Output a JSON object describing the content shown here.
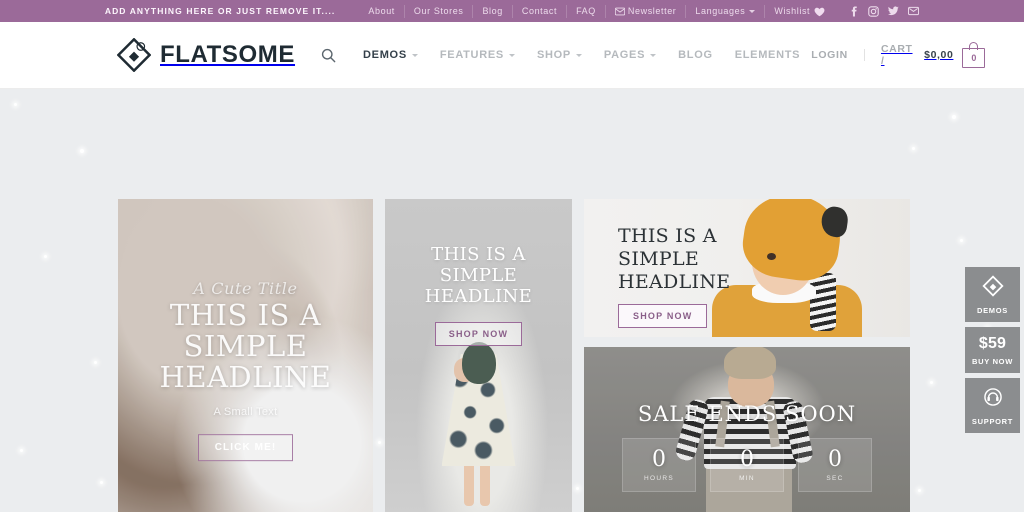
{
  "topbar": {
    "promo": "ADD ANYTHING HERE OR JUST REMOVE IT....",
    "links": [
      {
        "label": "About",
        "icon": null,
        "caret": false
      },
      {
        "label": "Our Stores",
        "icon": null,
        "caret": false
      },
      {
        "label": "Blog",
        "icon": null,
        "caret": false
      },
      {
        "label": "Contact",
        "icon": null,
        "caret": false
      },
      {
        "label": "FAQ",
        "icon": null,
        "caret": false
      },
      {
        "label": "Newsletter",
        "icon": "envelope-icon",
        "caret": false
      },
      {
        "label": "Languages",
        "icon": null,
        "caret": true
      },
      {
        "label": "Wishlist",
        "icon": "heart-icon",
        "caret": false
      }
    ],
    "social": [
      "facebook-icon",
      "instagram-icon",
      "twitter-icon",
      "email-icon"
    ],
    "bg_color": "#9b6a99"
  },
  "header": {
    "brand": "FLATSOME",
    "nav": [
      {
        "label": "DEMOS",
        "caret": true,
        "active": true
      },
      {
        "label": "FEATURES",
        "caret": true,
        "active": false
      },
      {
        "label": "SHOP",
        "caret": true,
        "active": false
      },
      {
        "label": "PAGES",
        "caret": true,
        "active": false
      },
      {
        "label": "BLOG",
        "caret": false,
        "active": false
      },
      {
        "label": "ELEMENTS",
        "caret": false,
        "active": false
      }
    ],
    "login": "LOGIN",
    "cart_label": "CART /",
    "cart_amount": "$0,00",
    "cart_count": "0"
  },
  "banners": {
    "hero_left": {
      "script_title": "A Cute Title",
      "headline_1": "THIS IS A",
      "headline_2": "SIMPLE",
      "headline_3": "HEADLINE",
      "subtitle": "A Small Text",
      "button": "CLICK ME!"
    },
    "middle": {
      "headline_1": "THIS IS A",
      "headline_2": "SIMPLE",
      "headline_3": "HEADLINE",
      "button": "SHOP NOW"
    },
    "top_right": {
      "headline_1": "THIS IS A",
      "headline_2": "SIMPLE",
      "headline_3": "HEADLINE",
      "button": "SHOP NOW"
    },
    "countdown": {
      "headline": "SALE ENDS SOON",
      "units": [
        {
          "value": "0",
          "label": "HOURS"
        },
        {
          "value": "0",
          "label": "MIN"
        },
        {
          "value": "0",
          "label": "SEC"
        }
      ]
    }
  },
  "side_widgets": [
    {
      "icon": "diamond-logo-icon",
      "label": "DEMOS",
      "price": null
    },
    {
      "icon": null,
      "label": "BUY NOW",
      "price": "$59"
    },
    {
      "icon": "headset-icon",
      "label": "SUPPORT",
      "price": null
    }
  ],
  "colors": {
    "accent_purple": "#9b6a99",
    "page_bg": "#ebedef",
    "text_dark": "#2c3236",
    "nav_muted": "#b5b9bd"
  }
}
